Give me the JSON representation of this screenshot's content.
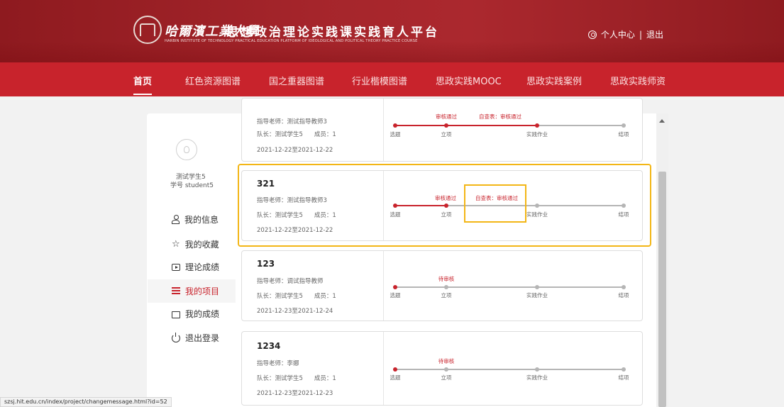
{
  "header": {
    "logo_calligraphy": "哈爾濱工業大學",
    "platform_title": "思想政治理论实践课实践育人平台",
    "platform_subtitle": "HARBIN INSTITUTE OF TECHNOLOGY PRACTICAL EDUCATION PLATFORM OF IDEOLOGICAL AND POLITICAL THEORY PRACTICE COURSE",
    "personal_center": "个人中心",
    "separator": "|",
    "logout": "退出"
  },
  "nav": {
    "items": [
      "首页",
      "红色资源图谱",
      "国之重器图谱",
      "行业楷模图谱",
      "思政实践MOOC",
      "思政实践案例",
      "思政实践师资"
    ],
    "active_index": 0
  },
  "sidebar": {
    "student_name": "测试学生5",
    "student_id": "学号 student5",
    "items": [
      {
        "label": "我的信息",
        "icon": "user-icon"
      },
      {
        "label": "我的收藏",
        "icon": "star-icon"
      },
      {
        "label": "理论成绩",
        "icon": "screen-icon"
      },
      {
        "label": "我的项目",
        "icon": "list-icon",
        "active": true
      },
      {
        "label": "我的成绩",
        "icon": "folder-icon"
      },
      {
        "label": "退出登录",
        "icon": "power-icon"
      }
    ]
  },
  "progress_steps": [
    "选题",
    "立项",
    "实践作业",
    "结项"
  ],
  "projects": [
    {
      "title": "",
      "teacher": "指导老师：测试指导教师3",
      "leader": "队长：测试学生5",
      "members": "成员：1",
      "dates": "2021-12-22至2021-12-22",
      "status_1": "审核通过",
      "status_2": "自查表：审核通过",
      "progress_filled": 2
    },
    {
      "title": "321",
      "teacher": "指导老师：测试指导教师3",
      "leader": "队长：测试学生5",
      "members": "成员：1",
      "dates": "2021-12-22至2021-12-22",
      "status_1": "审核通过",
      "status_2": "自查表：审核通过",
      "progress_filled": 1.5
    },
    {
      "title": "123",
      "teacher": "指导老师：调试指导教师",
      "leader": "队长：测试学生5",
      "members": "成员：1",
      "dates": "2021-12-23至2021-12-24",
      "status_1": "待审核",
      "status_2": "",
      "progress_filled": 0
    },
    {
      "title": "1234",
      "teacher": "指导老师：李娜",
      "leader": "队长：测试学生5",
      "members": "成员：1",
      "dates": "2021-12-23至2021-12-23",
      "status_1": "待审核",
      "status_2": "",
      "progress_filled": 0
    }
  ],
  "status_bar_url": "szsj.hit.edu.cn/index/project/changemessage.html?id=52",
  "colors": {
    "header_red": "#a5252b",
    "nav_red": "#c8232c",
    "highlight_yellow": "#f3b616",
    "progress_gray": "#b5b5b5"
  }
}
